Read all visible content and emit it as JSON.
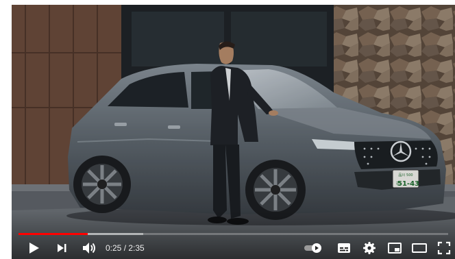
{
  "player": {
    "current_time": "0:25",
    "time_separator": " / ",
    "duration": "2:35",
    "progress_played": 0.161,
    "progress_buffered": 0.29,
    "accent_color": "#ff0000",
    "license_plate": {
      "top_line": "品川 500",
      "prefix": "む",
      "number": "51-43"
    }
  },
  "controls": {
    "play": "play-icon",
    "next": "next-icon",
    "volume": "volume-icon",
    "autoplay": "autoplay-toggle",
    "subtitles": "subtitles-icon",
    "settings": "gear-icon",
    "miniplayer": "miniplayer-icon",
    "theater": "theater-icon",
    "fullscreen": "fullscreen-icon"
  }
}
